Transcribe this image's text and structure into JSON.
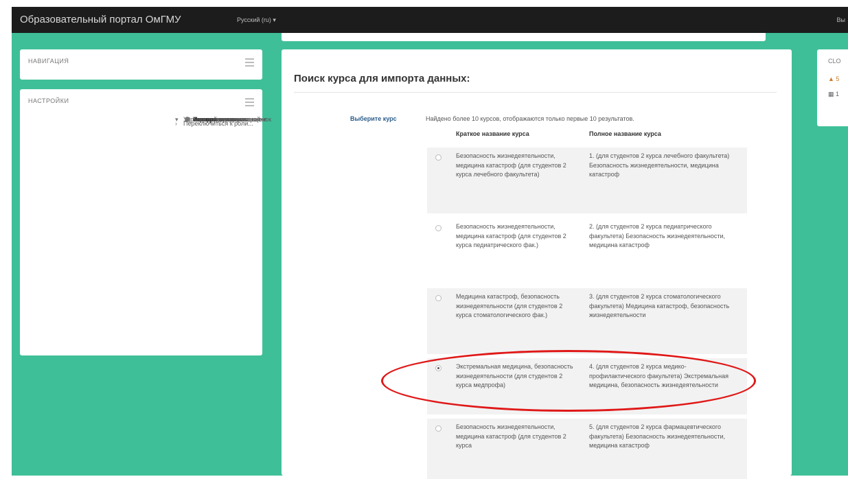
{
  "header": {
    "brand": "Образовательный портал ОмГМУ",
    "language": "Русский (ru) ▾",
    "user_cut": "Вы"
  },
  "navigation_block": {
    "title": "НАВИГАЦИЯ"
  },
  "settings_block": {
    "title": "НАСТРОЙКИ",
    "course_admin": "Управление курсом",
    "items": [
      {
        "icon": "pencil-icon",
        "glyph": "✎",
        "label": "Режим редактирования"
      },
      {
        "icon": "gear-icon",
        "glyph": "⚙",
        "label": "Редактировать настройки"
      },
      {
        "icon": "expand-icon",
        "glyph": "›",
        "label": "Пользователи"
      },
      {
        "icon": "filter-icon",
        "glyph": "▼",
        "label": "Фильтры"
      },
      {
        "icon": "expand-icon",
        "glyph": "›",
        "label": "Отчеты"
      },
      {
        "icon": "table-icon",
        "glyph": "▤",
        "label": "Оценки"
      },
      {
        "icon": "gear-icon",
        "glyph": "⚙",
        "label": "Настройка журнала оценок"
      },
      {
        "icon": "trophy-icon",
        "glyph": "♜",
        "label": "Показатели"
      },
      {
        "icon": "expand-icon",
        "glyph": "›",
        "label": "Значки"
      },
      {
        "icon": "upload-icon",
        "glyph": "⇧",
        "label": "Резервное копирование"
      },
      {
        "icon": "upload-icon",
        "glyph": "⇧",
        "label": "Восстановить"
      },
      {
        "icon": "download-icon",
        "glyph": "⇩",
        "label": "Импорт"
      },
      {
        "icon": "reset-icon",
        "glyph": "↺",
        "label": "Очистка"
      },
      {
        "icon": "expand-icon",
        "glyph": "›",
        "label": "Банк вопросов"
      }
    ],
    "switch_role": "Переключиться к роли..."
  },
  "main": {
    "heading": "Поиск курса для импорта данных:",
    "select_label": "Выберите курс",
    "found_note": "Найдено более 10 курсов, отображаются только первые 10 результатов.",
    "col_short": "Краткое название курса",
    "col_full": "Полное название курса",
    "courses": [
      {
        "short": "Безопасность жизнедеятельности, медицина катастроф (для студентов 2 курса лечебного факультета)",
        "full": "1. (для студентов 2 курса лечебного факультета) Безопасность жизнедеятельности, медицина катастроф",
        "selected": false
      },
      {
        "short": "Безопасность жизнедеятельности, медицина катастроф (для студентов 2 курса педиатрического фак.)",
        "full": "2. (для студентов 2 курса педиатрического факультета) Безопасность жизнедеятельности, медицина катастроф",
        "selected": false
      },
      {
        "short": "Медицина катастроф, безопасность жизнедеятельности (для студентов 2 курса стоматологического фак.)",
        "full": "3. (для студентов 2 курса стоматологического факультета) Медицина катастроф, безопасность жизнедеятельности",
        "selected": false
      },
      {
        "short": "Экстремальная медицина, безопасность жизнедеятельности (для студентов 2 курса медпрофа)",
        "full": "4. (для студентов 2 курса медико-профилактического факультета) Экстремальная медицина, безопасность жизнедеятельности",
        "selected": true
      },
      {
        "short": "Безопасность жизнедеятельности, медицина катастроф (для студентов 2 курса",
        "full": "5. (для студентов 2 курса фармацевтического факультета) Безопасность жизнедеятельности, медицина катастроф",
        "selected": false
      }
    ]
  },
  "right_block": {
    "title_cut": "CLO",
    "item1": "▲ 5",
    "item2": "▦ 1"
  },
  "annotation": {
    "color": "#e01818"
  }
}
